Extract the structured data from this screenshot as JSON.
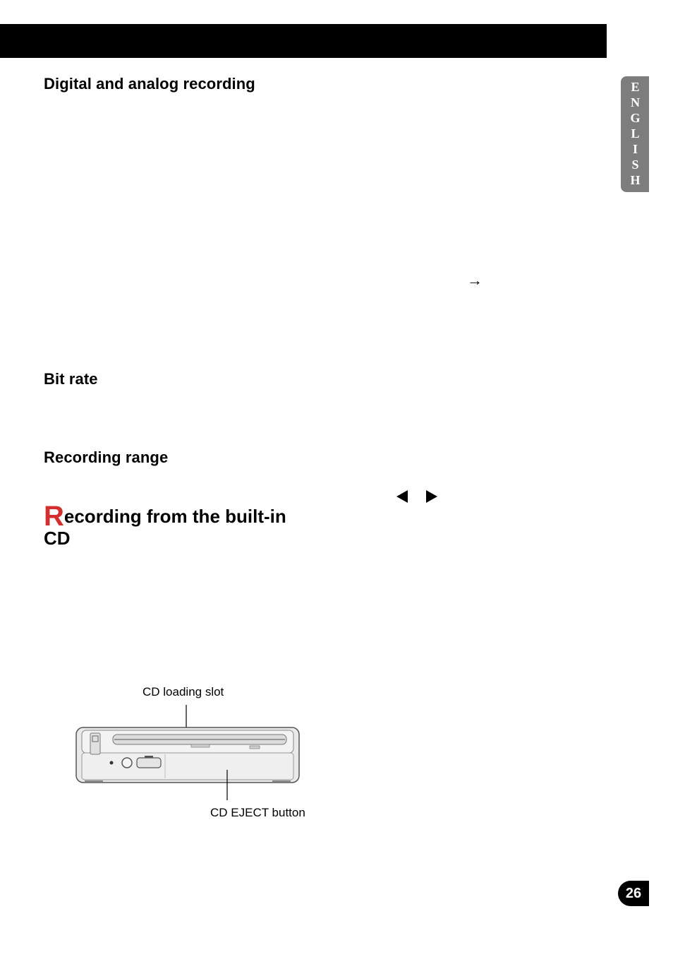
{
  "side_tab": {
    "language": "ENGLISH"
  },
  "page_number": "26",
  "sections": {
    "title1": "Digital and analog recording",
    "title2": "Bit rate",
    "title3": "Recording range",
    "big_title_initial": "R",
    "big_title_rest": "ecording from the built-in CD"
  },
  "diagram": {
    "label_top": "CD loading slot",
    "label_bottom": "CD EJECT button"
  },
  "glyphs": {
    "arrow_right": "→"
  }
}
